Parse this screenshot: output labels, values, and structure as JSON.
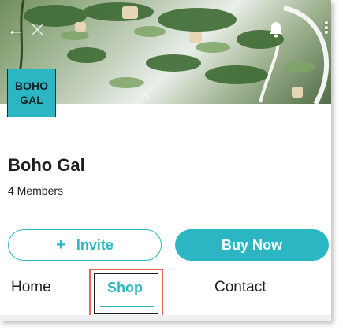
{
  "header": {
    "back_icon": "arrow-left-icon",
    "bell_icon": "bell-icon",
    "menu_icon": "more-vertical-icon"
  },
  "logo": {
    "line1": "BOHO",
    "line2": "GAL"
  },
  "group": {
    "title": "Boho Gal",
    "members": "4 Members"
  },
  "actions": {
    "invite_icon": "plus-icon",
    "invite_label": "Invite",
    "buy_label": "Buy Now"
  },
  "tabs": [
    {
      "label": "Home"
    },
    {
      "label": "Shop"
    },
    {
      "label": "Contact"
    }
  ],
  "colors": {
    "accent": "#2cb6c4",
    "highlight": "#e8664d"
  }
}
